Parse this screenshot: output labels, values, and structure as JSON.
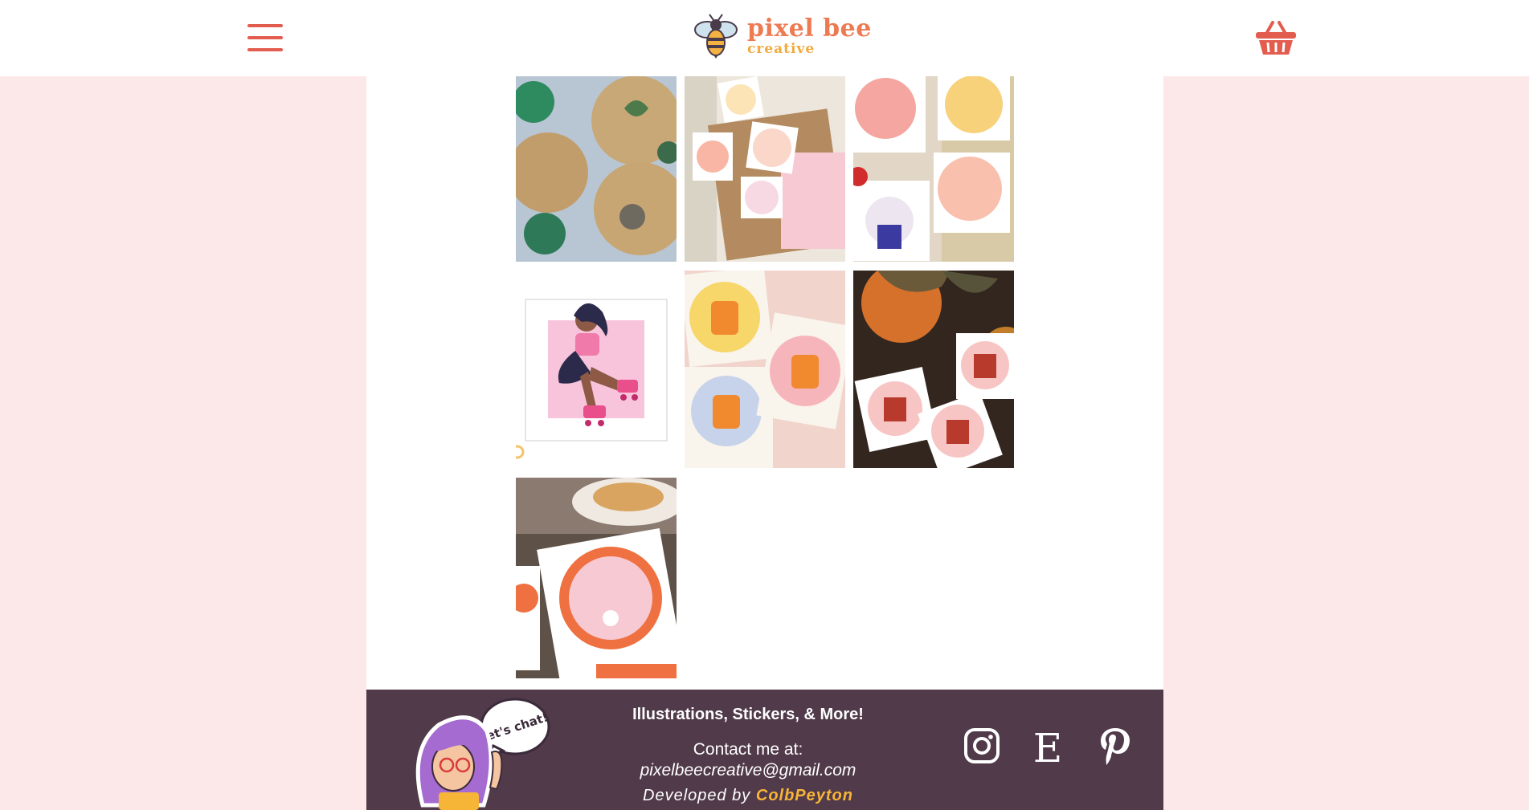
{
  "header": {
    "logo_title": "pixel bee",
    "logo_subtitle": "creative"
  },
  "gallery": {
    "items": [
      {
        "image": "eco-friendly-cork-stickers"
      },
      {
        "image": "work-hard-be-kind-stickers"
      },
      {
        "image": "its-okay-take-a-break-stickers"
      },
      {
        "image": "roller-skate-girl-illustration"
      },
      {
        "image": "just-a-lil-spicy-jar-stickers"
      },
      {
        "image": "cozy-character-stickers"
      },
      {
        "image": "make-life-sweeter-stickers"
      }
    ]
  },
  "footer": {
    "tagline": "Illustrations, Stickers, & More!",
    "contact_label": "Contact me at:",
    "email": "pixelbeecreative@gmail.com",
    "developed_by": "Developed by",
    "developer": "ColbPeyton",
    "mascot_bubble": "let's chat!",
    "social": [
      "instagram-icon",
      "etsy-icon",
      "pinterest-icon"
    ]
  },
  "colors": {
    "accent": "#e35d4f",
    "footer_bg": "#513a4a",
    "page_bg": "#fde8e9",
    "developer_highlight": "#f7b538"
  }
}
